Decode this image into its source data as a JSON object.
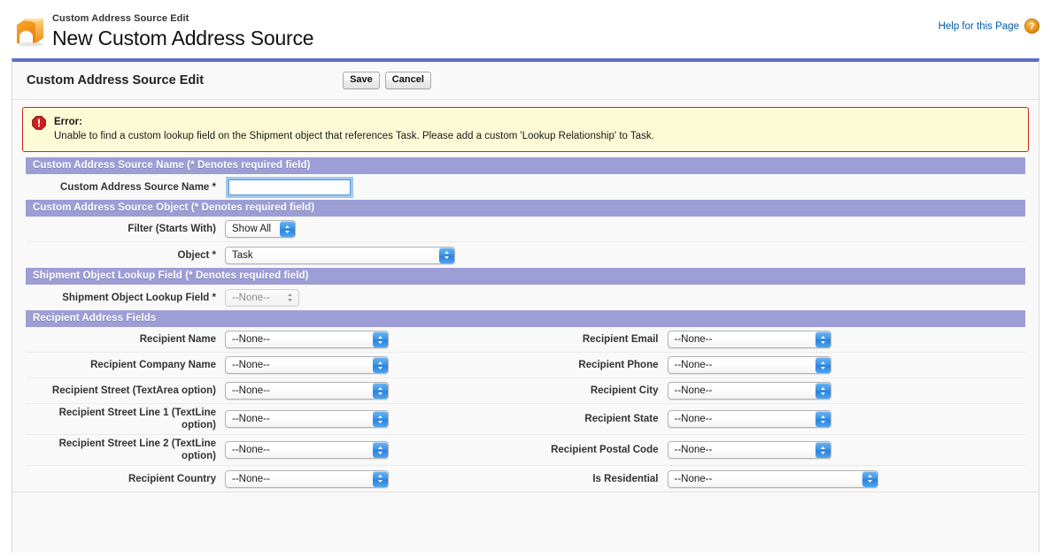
{
  "header": {
    "app_icon": "arch-tunnel-icon",
    "eyebrow": "Custom Address Source Edit",
    "title": "New Custom Address Source",
    "help_label": "Help for this Page",
    "help_icon": "question-mark-icon",
    "help_icon_glyph": "?"
  },
  "pagebar": {
    "title": "Custom Address Source Edit",
    "save_label": "Save",
    "cancel_label": "Cancel"
  },
  "error": {
    "icon": "error-octagon-icon",
    "title": "Error:",
    "message": "Unable to find a custom lookup field on the Shipment object that references Task. Please add a custom 'Lookup Relationship' to Task."
  },
  "sections": {
    "name": {
      "header": "Custom Address Source Name (* Denotes required field)",
      "field_label": "Custom Address Source Name *",
      "field_value": "",
      "field_placeholder": ""
    },
    "object": {
      "header": "Custom Address Source Object (* Denotes required field)",
      "filter_label": "Filter (Starts With)",
      "filter_value": "Show All",
      "object_label": "Object *",
      "object_value": "Task"
    },
    "lookup": {
      "header": "Shipment Object Lookup Field (* Denotes required field)",
      "field_label": "Shipment Object Lookup Field *",
      "field_value": "--None--"
    },
    "recipient": {
      "header": "Recipient Address Fields",
      "left_fields": [
        {
          "label": "Recipient Name",
          "value": "--None--"
        },
        {
          "label": "Recipient Company Name",
          "value": "--None--"
        },
        {
          "label": "Recipient Street (TextArea option)",
          "value": "--None--"
        },
        {
          "label": "Recipient Street Line 1 (TextLine option)",
          "value": "--None--"
        },
        {
          "label": "Recipient Street Line 2 (TextLine option)",
          "value": "--None--"
        },
        {
          "label": "Recipient Country",
          "value": "--None--"
        }
      ],
      "right_fields": [
        {
          "label": "Recipient Email",
          "value": "--None--"
        },
        {
          "label": "Recipient Phone",
          "value": "--None--"
        },
        {
          "label": "Recipient City",
          "value": "--None--"
        },
        {
          "label": "Recipient State",
          "value": "--None--"
        },
        {
          "label": "Recipient Postal Code",
          "value": "--None--"
        },
        {
          "label": "Is Residential",
          "value": "--None--"
        }
      ]
    }
  },
  "colors": {
    "panel_top_border": "#5d6fc6",
    "section_header_bg": "#9d9ed6",
    "error_border": "#c32a1f",
    "error_bg": "#fdfbd6",
    "link": "#015ba7",
    "select_button": "#3f96e8",
    "focus_ring": "#5596d8"
  }
}
